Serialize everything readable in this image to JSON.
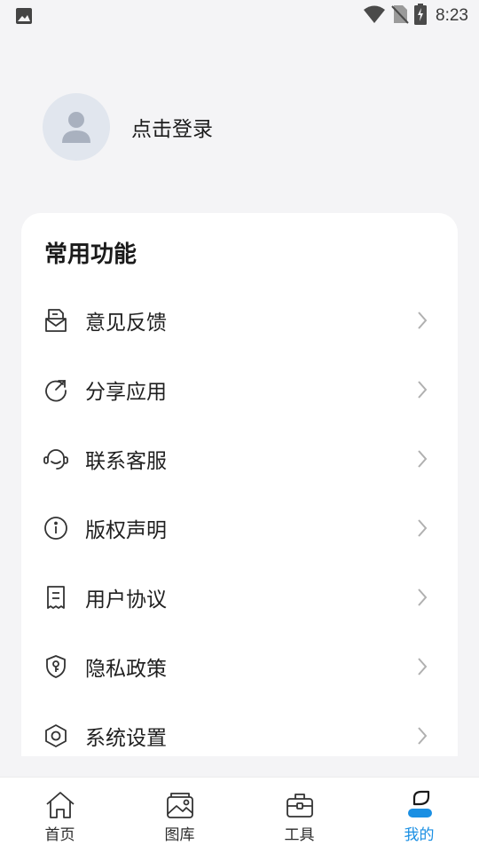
{
  "status_bar": {
    "time": "8:23"
  },
  "profile": {
    "login_label": "点击登录"
  },
  "card": {
    "title": "常用功能",
    "items": [
      {
        "label": "意见反馈",
        "icon": "feedback-icon"
      },
      {
        "label": "分享应用",
        "icon": "share-icon"
      },
      {
        "label": "联系客服",
        "icon": "headset-icon"
      },
      {
        "label": "版权声明",
        "icon": "info-icon"
      },
      {
        "label": "用户协议",
        "icon": "receipt-icon"
      },
      {
        "label": "隐私政策",
        "icon": "shield-key-icon"
      },
      {
        "label": "系统设置",
        "icon": "settings-icon"
      }
    ]
  },
  "tabbar": {
    "tabs": [
      {
        "label": "首页",
        "icon": "home-icon"
      },
      {
        "label": "图库",
        "icon": "gallery-icon"
      },
      {
        "label": "工具",
        "icon": "toolbox-icon"
      },
      {
        "label": "我的",
        "icon": "profile-icon"
      }
    ],
    "active_index": 3
  },
  "colors": {
    "accent": "#1a8fe3",
    "background": "#f4f4f6",
    "card": "#ffffff",
    "avatar_bg": "#e1e6ee",
    "avatar_fg": "#a9b1bf"
  }
}
